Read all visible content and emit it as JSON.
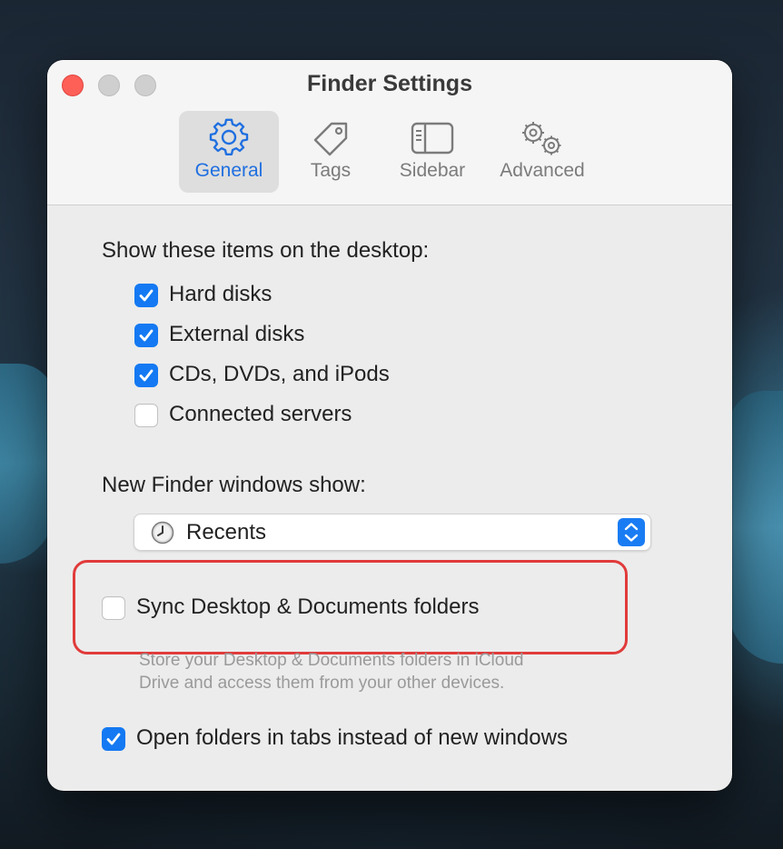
{
  "window": {
    "title": "Finder Settings"
  },
  "tabs": [
    {
      "label": "General",
      "icon": "gear-icon",
      "selected": true
    },
    {
      "label": "Tags",
      "icon": "tag-icon",
      "selected": false
    },
    {
      "label": "Sidebar",
      "icon": "sidebar-icon",
      "selected": false
    },
    {
      "label": "Advanced",
      "icon": "gears-icon",
      "selected": false
    }
  ],
  "desktop_section": {
    "heading": "Show these items on the desktop:",
    "items": [
      {
        "label": "Hard disks",
        "checked": true
      },
      {
        "label": "External disks",
        "checked": true
      },
      {
        "label": "CDs, DVDs, and iPods",
        "checked": true
      },
      {
        "label": "Connected servers",
        "checked": false
      }
    ]
  },
  "new_window": {
    "heading": "New Finder windows show:",
    "selected": "Recents",
    "icon": "clock-icon"
  },
  "sync": {
    "label": "Sync Desktop & Documents folders",
    "checked": false,
    "description_line1": "Store your Desktop & Documents folders in iCloud",
    "description_line2": "Drive and access them from your other devices."
  },
  "tabs_option": {
    "label": "Open folders in tabs instead of new windows",
    "checked": true
  },
  "colors": {
    "accent": "#1479f2",
    "highlight_border": "#e13b3b",
    "close_button": "#fe5f57"
  }
}
